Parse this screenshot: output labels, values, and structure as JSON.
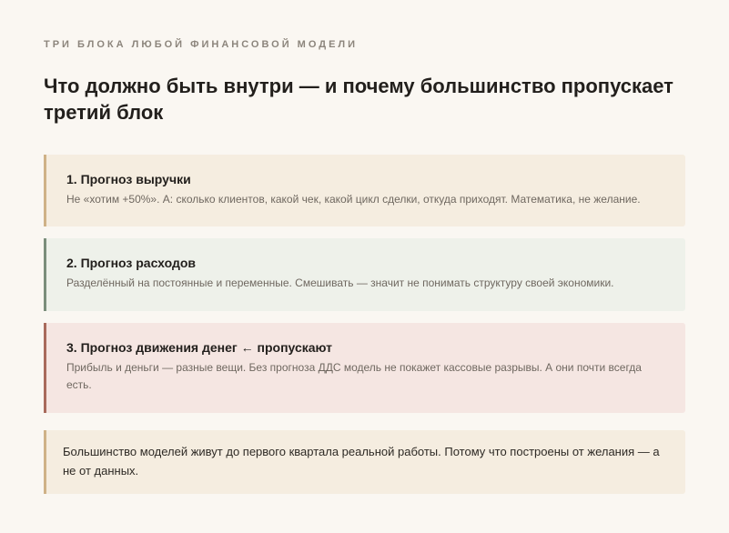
{
  "header": {
    "eyebrow": "ТРИ БЛОКА ЛЮБОЙ ФИНАНСОВОЙ МОДЕЛИ",
    "title": "Что должно быть внутри — и почему большинство пропускает третий блок"
  },
  "blocks": [
    {
      "title": "1. Прогноз выручки",
      "text": "Не «хотим +50%». А: сколько клиентов, какой чек, какой цикл сделки, откуда приходят. Математика, не желание."
    },
    {
      "title": "2. Прогноз расходов",
      "text": "Разделённый на постоянные и переменные. Смешивать — значит не понимать структуру своей экономики."
    },
    {
      "title": "3. Прогноз движения денег ← пропускают",
      "text": "Прибыль и деньги — разные вещи. Без прогноза ДДС модель не покажет кассовые разрывы. А они почти всегда есть."
    }
  ],
  "callout": {
    "text": "Большинство моделей живут до первого квартала реальной работы. Потому что построены от желания — а не от данных."
  },
  "colors": {
    "background": "#faf7f2",
    "block1_bg": "#f5ede0",
    "block1_accent": "#cfb287",
    "block2_bg": "#eef1ea",
    "block2_accent": "#7b8e7b",
    "block3_bg": "#f5e6e2",
    "block3_accent": "#a86a5c"
  }
}
